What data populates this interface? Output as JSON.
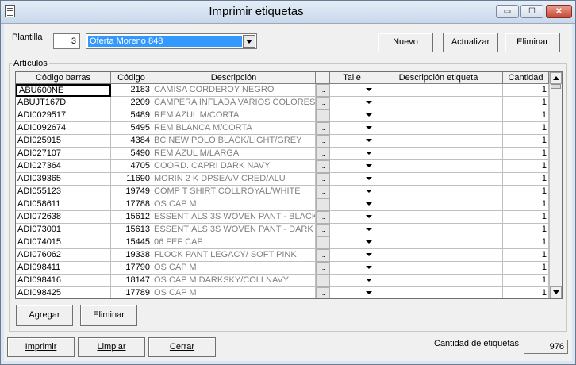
{
  "window": {
    "title": "Imprimir etiquetas",
    "buttons": {
      "minimize": "▭",
      "maximize": "☐",
      "close": "✕"
    }
  },
  "plantilla": {
    "label": "Plantilla",
    "number": "3",
    "selected": "Oferta Moreno 848"
  },
  "top_buttons": {
    "nuevo": "Nuevo",
    "actualizar": "Actualizar",
    "eliminar": "Eliminar"
  },
  "articulos": {
    "group_label": "Artículos",
    "columns": [
      "Código barras",
      "Código",
      "Descripción",
      "",
      "Talle",
      "Descripción etiqueta",
      "Cantidad"
    ],
    "rows": [
      {
        "barcode": "ABU600NE",
        "code": "2183",
        "desc": "CAMISA CORDEROY NEGRO",
        "qty": "1"
      },
      {
        "barcode": "ABUJT167D",
        "code": "2209",
        "desc": "CAMPERA INFLADA VARIOS COLORES",
        "qty": "1"
      },
      {
        "barcode": "ADI0029517",
        "code": "5489",
        "desc": "REM AZUL M/CORTA",
        "qty": "1"
      },
      {
        "barcode": "ADI0092674",
        "code": "5495",
        "desc": "REM BLANCA M/CORTA",
        "qty": "1"
      },
      {
        "barcode": "ADI025915",
        "code": "4384",
        "desc": "BC NEW POLO BLACK/LIGHT/GREY",
        "qty": "1"
      },
      {
        "barcode": "ADI027107",
        "code": "5490",
        "desc": "REM AZUL M/LARGA",
        "qty": "1"
      },
      {
        "barcode": "ADI027364",
        "code": "4705",
        "desc": "COORD. CAPRI DARK NAVY",
        "qty": "1"
      },
      {
        "barcode": "ADI039365",
        "code": "11690",
        "desc": "MORIN 2 K DPSEA/VICRED/ALU",
        "qty": "1"
      },
      {
        "barcode": "ADI055123",
        "code": "19749",
        "desc": "COMP T SHIRT COLLROYAL/WHITE",
        "qty": "1"
      },
      {
        "barcode": "ADI058611",
        "code": "17788",
        "desc": "OS CAP M",
        "qty": "1"
      },
      {
        "barcode": "ADI072638",
        "code": "15612",
        "desc": "ESSENTIALS 3S WOVEN PANT - BLACK",
        "qty": "1"
      },
      {
        "barcode": "ADI073001",
        "code": "15613",
        "desc": "ESSENTIALS 3S WOVEN PANT - DARK N",
        "qty": "1"
      },
      {
        "barcode": "ADI074015",
        "code": "15445",
        "desc": "06 FEF CAP",
        "qty": "1"
      },
      {
        "barcode": "ADI076062",
        "code": "19338",
        "desc": "FLOCK PANT LEGACY/ SOFT PINK",
        "qty": "1"
      },
      {
        "barcode": "ADI098411",
        "code": "17790",
        "desc": "OS CAP M",
        "qty": "1"
      },
      {
        "barcode": "ADI098416",
        "code": "18147",
        "desc": "OS CAP M DARKSKY/COLLNAVY",
        "qty": "1"
      },
      {
        "barcode": "ADI098425",
        "code": "17789",
        "desc": "OS CAP M",
        "qty": "1"
      }
    ],
    "ellipsis": "...",
    "agregar": "Agregar",
    "eliminar": "Eliminar"
  },
  "bottom": {
    "imprimir": "Imprimir",
    "limpiar": "Limpiar",
    "cerrar": "Cerrar",
    "cantidad_label": "Cantidad de etiquetas",
    "cantidad_value": "976"
  }
}
